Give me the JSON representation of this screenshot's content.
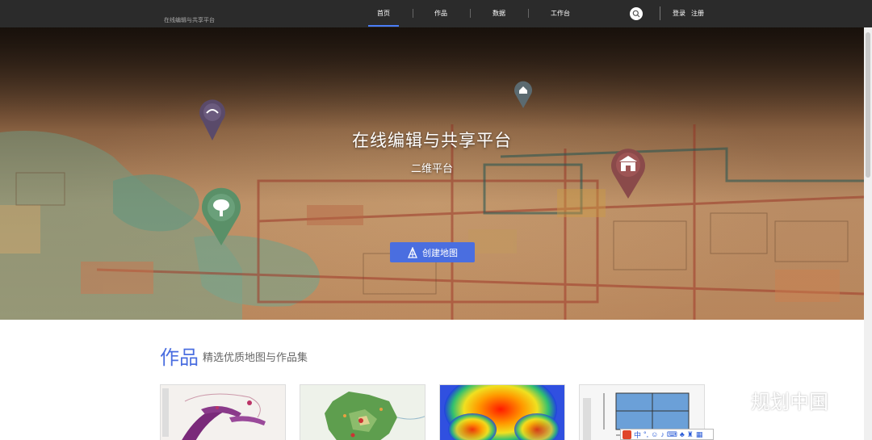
{
  "header": {
    "brand_text": "在线编辑与共享平台",
    "nav": [
      {
        "label": "首页",
        "active": true
      },
      {
        "label": "作品",
        "active": false
      },
      {
        "label": "数据",
        "active": false
      },
      {
        "label": "工作台",
        "active": false
      }
    ],
    "login_label": "登录",
    "register_label": "注册"
  },
  "hero": {
    "title": "在线编辑与共享平台",
    "subtitle": "二维平台",
    "create_button_label": "创建地图"
  },
  "works": {
    "title": "作品",
    "subtitle": "精选优质地图与作品集",
    "cards": [
      {
        "thumbnail": "flow-map"
      },
      {
        "thumbnail": "district-map"
      },
      {
        "thumbnail": "heat-map"
      },
      {
        "thumbnail": "table-diagram"
      }
    ]
  },
  "overlay": {
    "watermark_text": "规划中国",
    "ime_label": "中"
  },
  "colors": {
    "accent": "#4a6ee0",
    "topbar": "#2b2b2b"
  }
}
